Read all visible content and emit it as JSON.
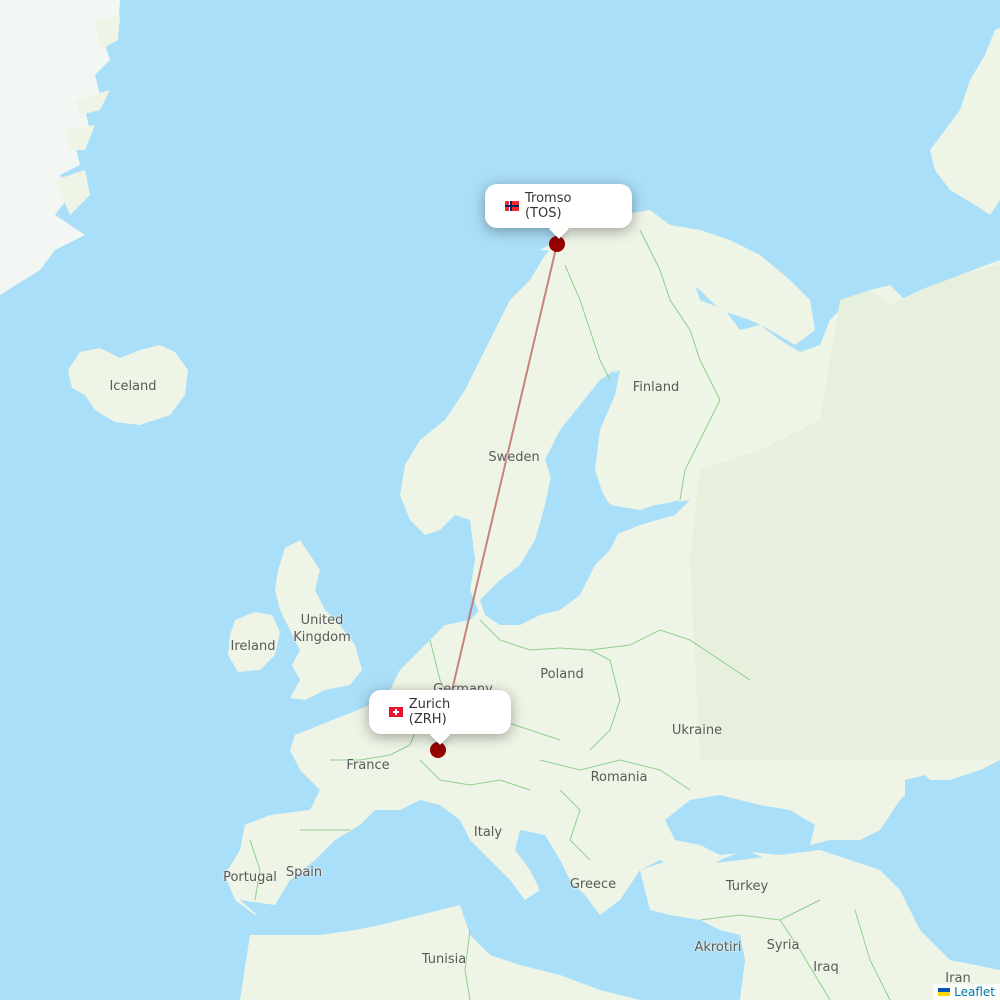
{
  "map": {
    "colors": {
      "water": "#aadff9",
      "land": "#eef5e6",
      "ice": "#f2f7f4",
      "border": "#8fcf8f",
      "route": "#c0706a",
      "marker": "#990000"
    },
    "route": {
      "from": "Zurich (ZRH)",
      "to": "Tromso (TOS)"
    },
    "popups": [
      {
        "label": "Tromso (TOS)",
        "flag": "norway-flag-icon"
      },
      {
        "label": "Zurich (ZRH)",
        "flag": "switzerland-flag-icon"
      }
    ],
    "country_labels": [
      "Iceland",
      "Finland",
      "Sweden",
      "United",
      "Kingdom",
      "Ireland",
      "Germany",
      "Poland",
      "Ukraine",
      "France",
      "Romania",
      "Italy",
      "Portugal",
      "Spain",
      "Greece",
      "Turkey",
      "Tunisia",
      "Akrotiri",
      "Syria",
      "Iraq",
      "Iran"
    ],
    "attribution": "Leaflet"
  }
}
